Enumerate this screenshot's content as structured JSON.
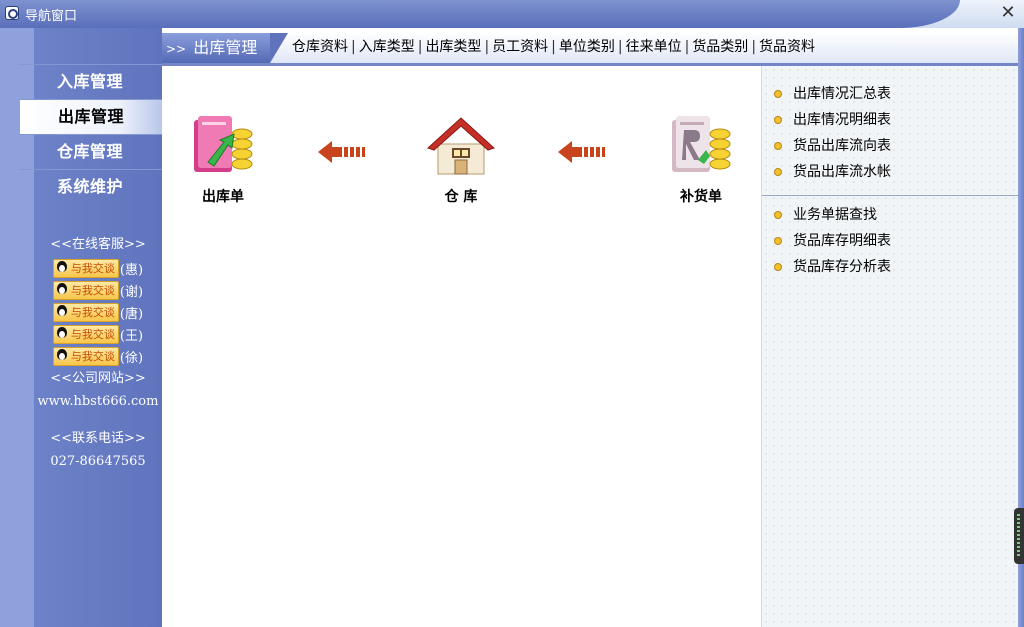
{
  "window": {
    "title": "导航窗口",
    "close_glyph": "✕"
  },
  "sidebar": {
    "items": [
      {
        "label": "入库管理",
        "active": false
      },
      {
        "label": "出库管理",
        "active": true
      },
      {
        "label": "仓库管理",
        "active": false
      },
      {
        "label": "系统维护",
        "active": false
      }
    ],
    "service_title": "<<在线客服>>",
    "qq_button_label": "与我交谈",
    "qq_contacts": [
      "(惠)",
      "(谢)",
      "(唐)",
      "(王)",
      "(徐)"
    ],
    "website_title": "<<公司网站>>",
    "website": "www.hbst666.com",
    "phone_title": "<<联系电话>>",
    "phone": "027-86647565"
  },
  "tabbar": {
    "current_prefix": ">>",
    "current": "出库管理",
    "links": [
      "仓库资料",
      "入库类型",
      "出库类型",
      "员工资料",
      "单位类别",
      "往来单位",
      "货品类别",
      "货品资料"
    ],
    "separator": "|"
  },
  "flow": {
    "items": [
      {
        "label": "出库单",
        "icon": "outbound-document-icon"
      },
      {
        "label": "仓  库",
        "icon": "warehouse-house-icon"
      },
      {
        "label": "补货单",
        "icon": "replenish-document-icon"
      }
    ],
    "arrow_icon": "left-arrow-icon"
  },
  "reports": {
    "group1": [
      "出库情况汇总表",
      "出库情况明细表",
      "货品出库流向表",
      "货品出库流水帐"
    ],
    "group2": [
      "业务单据查找",
      "货品库存明细表",
      "货品库存分析表"
    ]
  },
  "colors": {
    "sidebar": "#6d82c8",
    "accent_dark": "#5469b5",
    "bullet": "#f2c22a"
  }
}
